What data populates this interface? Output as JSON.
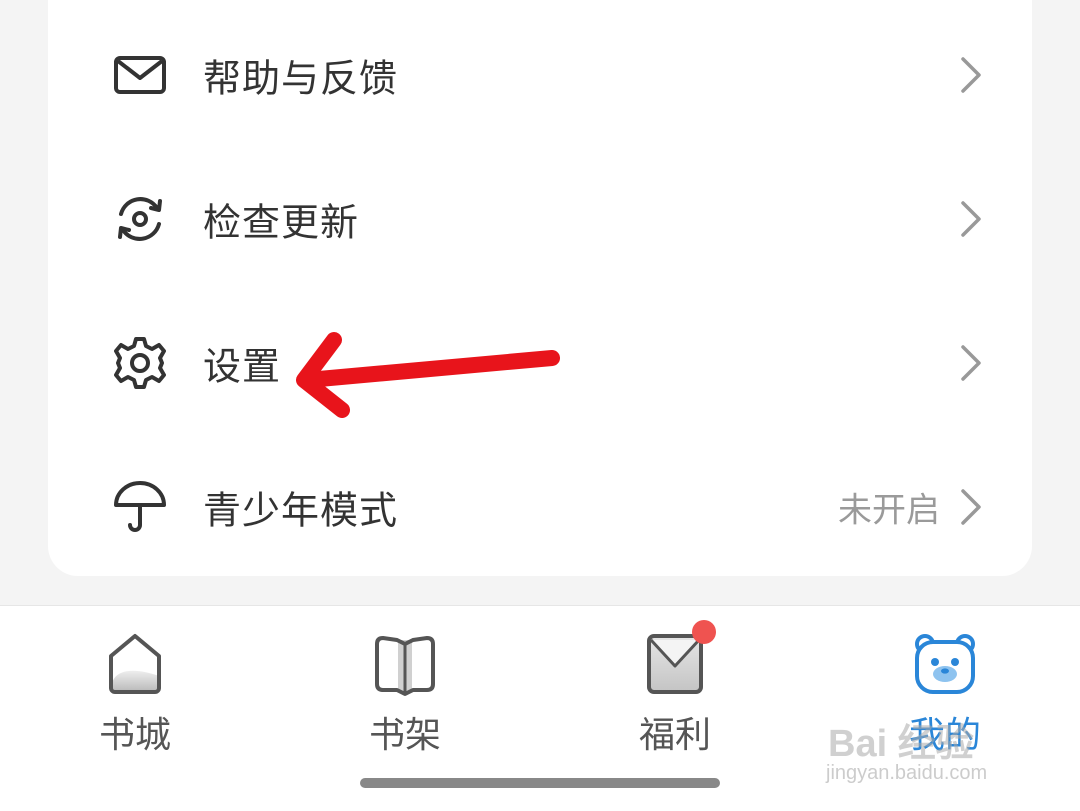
{
  "menu": {
    "items": [
      {
        "label": "帮助与反馈",
        "icon": "mail-icon"
      },
      {
        "label": "检查更新",
        "icon": "refresh-icon"
      },
      {
        "label": "设置",
        "icon": "gear-icon"
      },
      {
        "label": "青少年模式",
        "icon": "umbrella-icon",
        "status": "未开启"
      }
    ]
  },
  "tabbar": {
    "tabs": [
      {
        "label": "书城",
        "icon": "home-icon"
      },
      {
        "label": "书架",
        "icon": "book-icon"
      },
      {
        "label": "福利",
        "icon": "envelope-icon",
        "badge": true
      },
      {
        "label": "我的",
        "icon": "bear-avatar-icon",
        "active": true
      }
    ]
  },
  "colors": {
    "accent": "#2a86d8",
    "badge": "#ef5350",
    "annotation_arrow": "#e8141b"
  },
  "watermark": {
    "brand": "Bai 经验",
    "url": "jingyan.baidu.com"
  }
}
